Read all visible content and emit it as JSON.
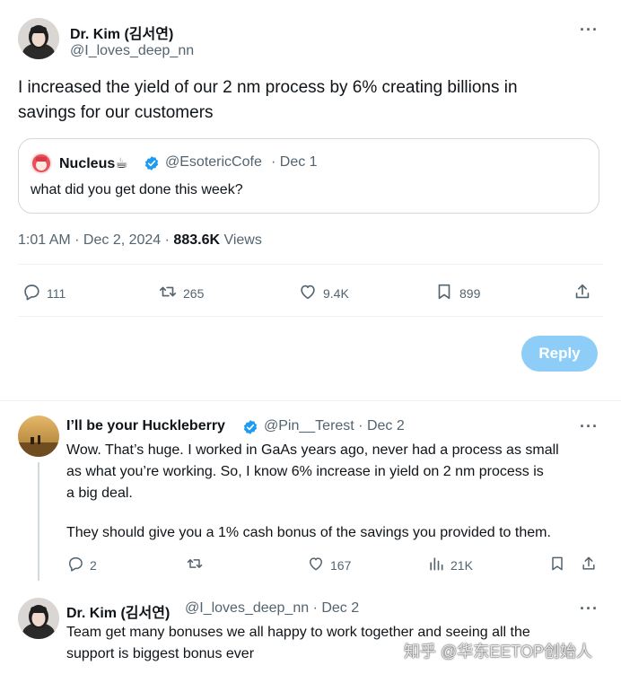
{
  "main_tweet": {
    "author_name": "Dr. Kim (김서연)",
    "author_handle": "@I_loves_deep_nn",
    "text_line1": "I increased the yield of our 2 nm process by 6% creating billions in",
    "text_line2": "savings for our customers",
    "quote": {
      "author_name": "Nucleus☕",
      "author_handle": "@EsotericCofe",
      "date": "· Dec 1",
      "text": "what did you get done this week?"
    },
    "timestamp": "1:01 AM · Dec 2, 2024 · ",
    "views_count": "883.6K",
    "views_label": " Views",
    "stats": {
      "replies": "111",
      "reposts": "265",
      "likes": "9.4K",
      "bookmarks": "899"
    },
    "reply_button": "Reply"
  },
  "reply1": {
    "author_name": "I’ll be your Huckleberry",
    "author_handle": "@Pin__Terest · Dec 2",
    "para1_line1": "Wow. That’s huge. I worked in GaAs years ago, never had a process as small",
    "para1_line2": "as what you’re working.   So, I know 6% increase in yield on 2 nm process is",
    "para1_line3": "a big deal.",
    "para2": "They should give you a 1% cash bonus of the savings you provided to them.",
    "stats": {
      "replies": "2",
      "reposts": "",
      "likes": "167",
      "views": "21K"
    }
  },
  "reply2": {
    "author_name": "Dr. Kim (김서연)",
    "author_handle": "@I_loves_deep_nn · Dec 2",
    "line1": "Team get many bonuses we all happy to work together and seeing all the",
    "line2": "support is biggest bonus ever"
  },
  "watermark": "知乎 @华东EETOP创始人",
  "colors": {
    "accent": "#1d9bf0",
    "reply_button": "#8ecdf8",
    "muted": "#536471"
  }
}
